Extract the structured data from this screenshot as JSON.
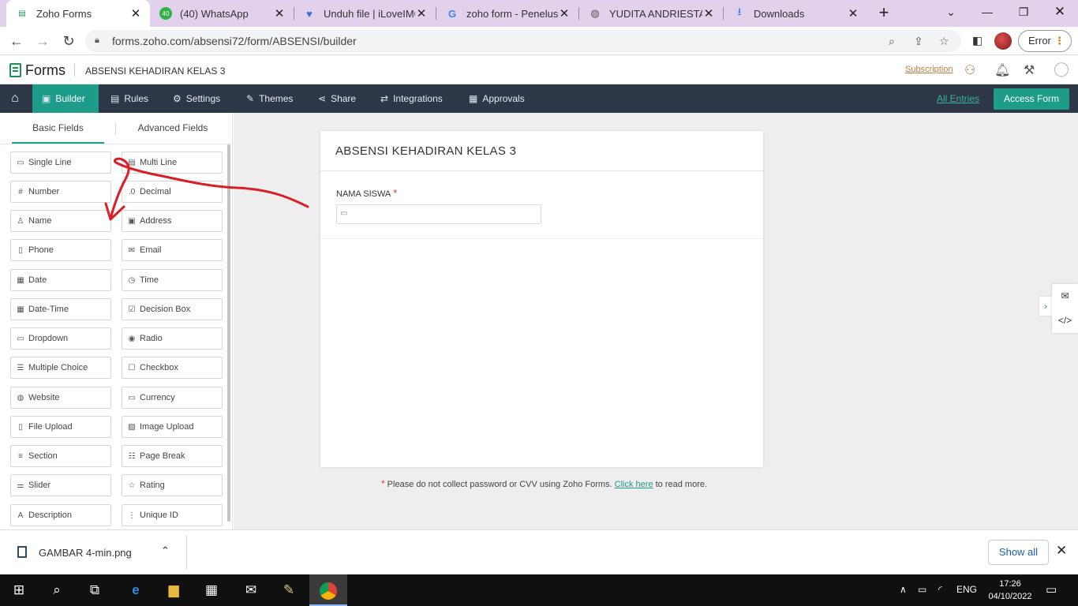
{
  "browser": {
    "tabs": [
      {
        "title": "Zoho Forms",
        "icon": "zoho-forms-icon",
        "active": true
      },
      {
        "title": "(40) WhatsApp",
        "icon": "whatsapp-icon",
        "badge": "40"
      },
      {
        "title": "Unduh file | iLoveIMG",
        "icon": "heart-icon"
      },
      {
        "title": "zoho form - Penelusur",
        "icon": "google-icon"
      },
      {
        "title": "YUDITA ANDRIESTA L",
        "icon": "globe-icon"
      },
      {
        "title": "Downloads",
        "icon": "download-icon"
      }
    ],
    "url": "forms.zoho.com/absensi72/form/ABSENSI/builder",
    "profile_button": "Error"
  },
  "app": {
    "logo": "Forms",
    "form_name": "ABSENSI KEHADIRAN KELAS 3",
    "subscription_link": "Subscription"
  },
  "nav": {
    "items": [
      {
        "label": "Builder",
        "icon": "builder-icon",
        "active": true
      },
      {
        "label": "Rules",
        "icon": "rules-icon"
      },
      {
        "label": "Settings",
        "icon": "gear-icon"
      },
      {
        "label": "Themes",
        "icon": "themes-icon"
      },
      {
        "label": "Share",
        "icon": "share-icon"
      },
      {
        "label": "Integrations",
        "icon": "integrations-icon"
      },
      {
        "label": "Approvals",
        "icon": "approvals-icon"
      }
    ],
    "all_entries": "All Entries",
    "access_form": "Access Form"
  },
  "panel": {
    "tabs": [
      "Basic Fields",
      "Advanced Fields"
    ],
    "fields": [
      [
        "Single Line",
        "Multi Line"
      ],
      [
        "Number",
        "Decimal"
      ],
      [
        "Name",
        "Address"
      ],
      [
        "Phone",
        "Email"
      ],
      [
        "Date",
        "Time"
      ],
      [
        "Date-Time",
        "Decision Box"
      ],
      [
        "Dropdown",
        "Radio"
      ],
      [
        "Multiple Choice",
        "Checkbox"
      ],
      [
        "Website",
        "Currency"
      ],
      [
        "File Upload",
        "Image Upload"
      ],
      [
        "Section",
        "Page Break"
      ],
      [
        "Slider",
        "Rating"
      ],
      [
        "Description",
        "Unique ID"
      ]
    ]
  },
  "form": {
    "title": "ABSENSI KEHADIRAN KELAS 3",
    "field_label": "NAMA SISWA",
    "required_mark": "*"
  },
  "disclaimer": {
    "star": "*",
    "text": "Please do not collect password or CVV using Zoho Forms.",
    "link": "Click here",
    "suffix": "to read more."
  },
  "downloads": {
    "file": "GAMBAR 4-min.png",
    "show_all": "Show all"
  },
  "taskbar": {
    "language": "ENG",
    "time": "17:26",
    "date": "04/10/2022"
  },
  "colors": {
    "accent": "#1d9c8a",
    "navbar": "#2d3747",
    "tabstrip": "#e2d1ed",
    "annotation_arrow": "#d81f26"
  }
}
